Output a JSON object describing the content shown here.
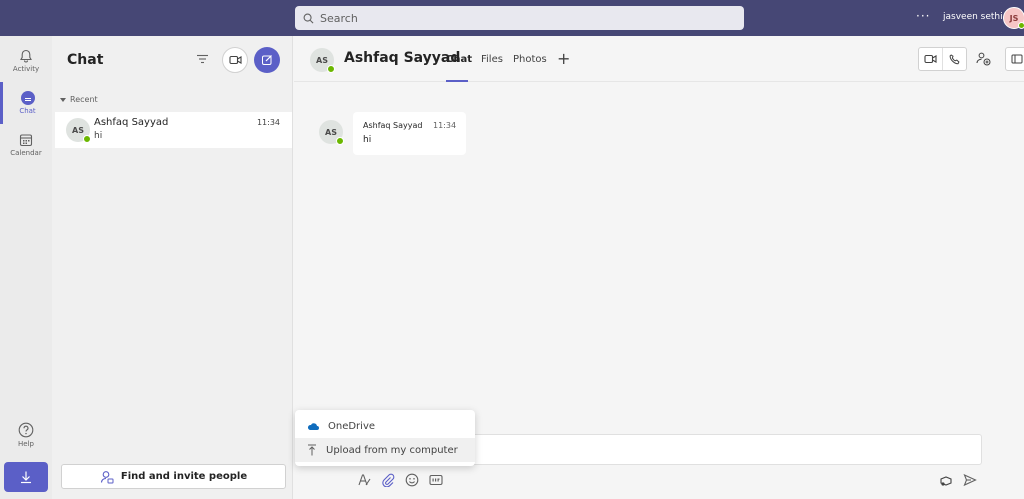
{
  "topbar": {
    "search_placeholder": "Search",
    "more": "···",
    "user_name": "jasveen sethi",
    "user_initials": "JS"
  },
  "rail": {
    "items": [
      {
        "label": "Activity",
        "icon": "bell-icon"
      },
      {
        "label": "Chat",
        "icon": "chat-icon"
      },
      {
        "label": "Calendar",
        "icon": "calendar-icon"
      },
      {
        "label": "Help",
        "icon": "help-icon"
      }
    ],
    "download_icon": "download-icon"
  },
  "list": {
    "title": "Chat",
    "section": "Recent",
    "items": [
      {
        "initials": "AS",
        "name": "Ashfaq Sayyad",
        "time": "11:34",
        "preview": "hi"
      }
    ],
    "invite_label": "Find and invite people"
  },
  "conversation": {
    "initials": "AS",
    "title": "Ashfaq Sayyad",
    "tabs": [
      {
        "label": "Chat",
        "active": true
      },
      {
        "label": "Files",
        "active": false
      },
      {
        "label": "Photos",
        "active": false
      }
    ],
    "add_tab": "+",
    "messages": [
      {
        "initials": "AS",
        "sender": "Ashfaq Sayyad",
        "time": "11:34",
        "text": "hi"
      }
    ]
  },
  "attach_menu": {
    "items": [
      {
        "label": "OneDrive",
        "icon": "cloud-icon"
      },
      {
        "label": "Upload from my computer",
        "icon": "upload-icon"
      }
    ]
  },
  "colors": {
    "brand": "#464775",
    "accent": "#5b5fc7",
    "presence": "#6bb700"
  }
}
